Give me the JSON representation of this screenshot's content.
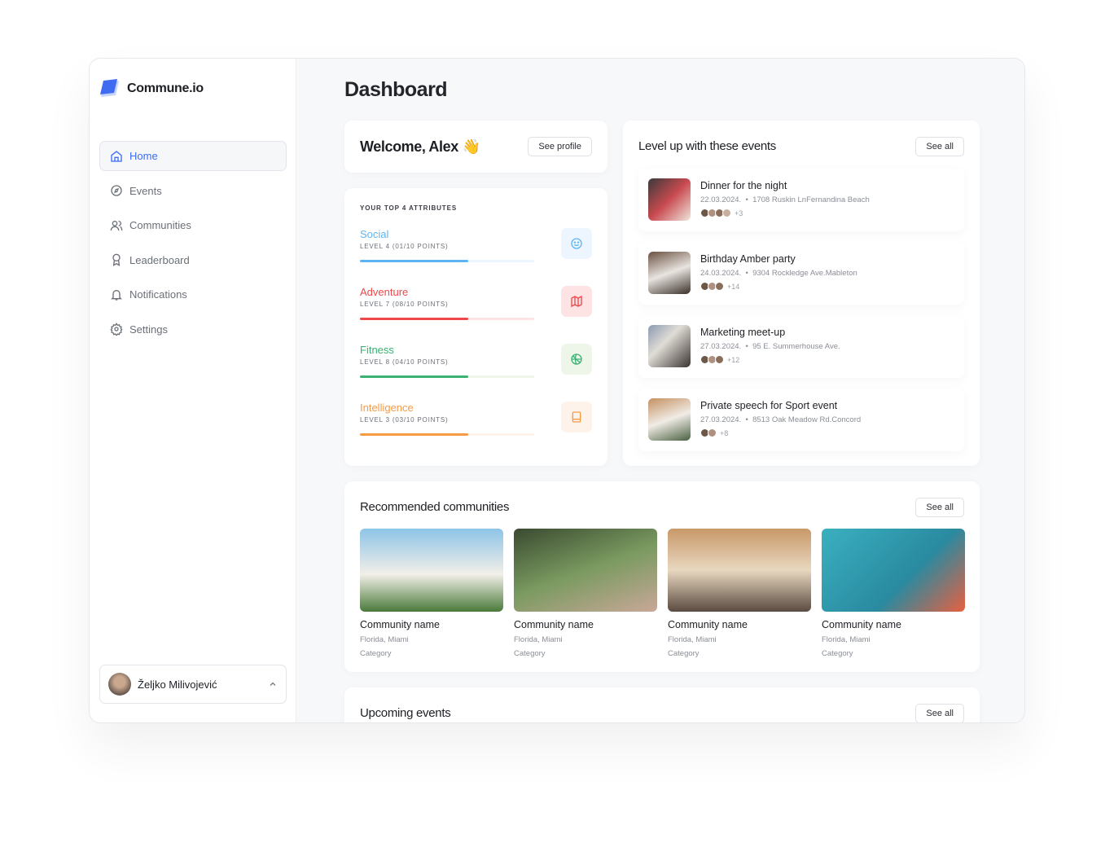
{
  "app": {
    "name": "Commune.io"
  },
  "sidebar": {
    "items": [
      {
        "label": "Home",
        "icon": "home-icon"
      },
      {
        "label": "Events",
        "icon": "compass-icon"
      },
      {
        "label": "Communities",
        "icon": "users-icon"
      },
      {
        "label": "Leaderboard",
        "icon": "award-icon"
      },
      {
        "label": "Notifications",
        "icon": "bell-icon"
      },
      {
        "label": "Settings",
        "icon": "gear-icon"
      }
    ],
    "active": "Home",
    "user": {
      "name": "Željko Milivojević"
    }
  },
  "page": {
    "title": "Dashboard"
  },
  "welcome": {
    "text": "Welcome, Alex",
    "emoji": "👋",
    "button": "See profile"
  },
  "attributes": {
    "heading": "YOUR TOP 4 ATTRIBUTES",
    "items": [
      {
        "name": "Social",
        "level": "LEVEL 4 (01/10 POINTS)",
        "progress": 0.62,
        "color": "#5eb4f3",
        "bg": "#edf6fe",
        "icon": "smile-icon"
      },
      {
        "name": "Adventure",
        "level": "LEVEL 7 (08/10 POINTS)",
        "progress": 0.62,
        "color": "#f0474a",
        "bg": "#fde3e3",
        "icon": "map-icon"
      },
      {
        "name": "Fitness",
        "level": "LEVEL 8 (04/10 POINTS)",
        "progress": 0.62,
        "color": "#3bb273",
        "bg": "#eef6ea",
        "icon": "basketball-icon"
      },
      {
        "name": "Intelligence",
        "level": "LEVEL 3 (03/10 POINTS)",
        "progress": 0.62,
        "color": "#f79a44",
        "bg": "#fdf3ea",
        "icon": "book-icon"
      }
    ]
  },
  "events": {
    "title": "Level up with these events",
    "see_all": "See all",
    "items": [
      {
        "title": "Dinner for the night",
        "date": "22.03.2024.",
        "address": "1708 Ruskin LnFernandina Beach",
        "extra": "+3",
        "avatars": 4
      },
      {
        "title": "Birthday Amber party",
        "date": "24.03.2024.",
        "address": "9304 Rockledge Ave.Mableton",
        "extra": "+14",
        "avatars": 3
      },
      {
        "title": "Marketing meet-up",
        "date": "27.03.2024.",
        "address": "95 E. Summerhouse Ave.",
        "extra": "+12",
        "avatars": 3
      },
      {
        "title": "Private speech for Sport event",
        "date": "27.03.2024.",
        "address": "8513 Oak Meadow Rd.Concord",
        "extra": "+8",
        "avatars": 2
      }
    ]
  },
  "communities": {
    "title": "Recommended communities",
    "see_all": "See all",
    "items": [
      {
        "name": "Community name",
        "location": "Florida, Miami",
        "category": "Category"
      },
      {
        "name": "Community name",
        "location": "Florida, Miami",
        "category": "Category"
      },
      {
        "name": "Community name",
        "location": "Florida, Miami",
        "category": "Category"
      },
      {
        "name": "Community name",
        "location": "Florida, Miami",
        "category": "Category"
      }
    ]
  },
  "upcoming": {
    "title": "Upcoming events",
    "see_all": "See all"
  }
}
